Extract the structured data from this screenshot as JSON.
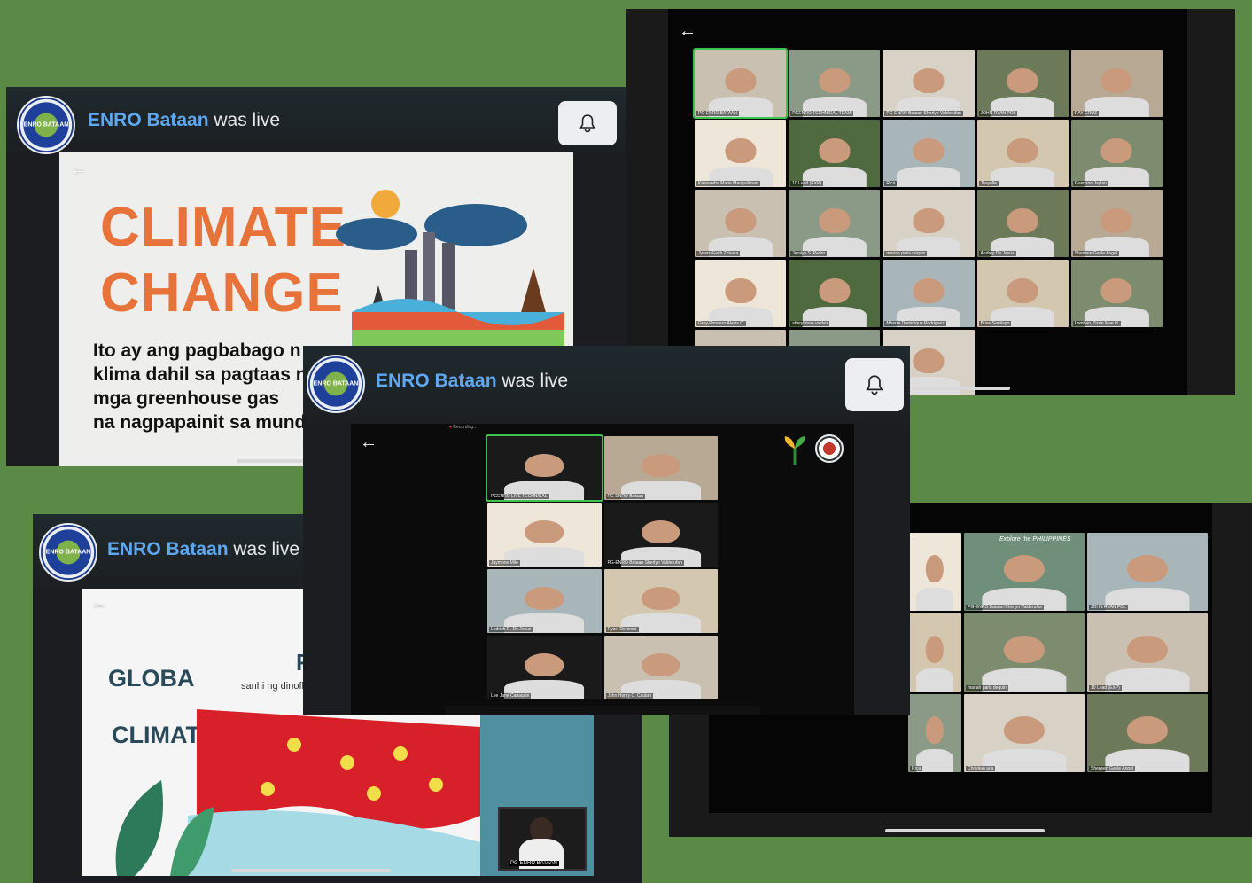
{
  "brand": {
    "name": "ENRO Bataan",
    "suffix": "was live",
    "logo_text": "ENRO BATAAN"
  },
  "colors": {
    "background": "#5b8a47",
    "name_blue": "#5fa7ef",
    "climate_orange": "#e8733a",
    "active_tile_green": "#3cc24e"
  },
  "icons": {
    "bell": "bell-icon",
    "back": "back-arrow-icon"
  },
  "back_glyph": "←",
  "slide1": {
    "title_line1": "CLIMATE",
    "title_line2": "CHANGE",
    "body": [
      "Ito ay ang pagbabago n",
      "klima dahil sa pagtaas n",
      "mga greenhouse gas",
      "na nagpapainit sa mund"
    ]
  },
  "slide2": {
    "word1": "GLOBA",
    "word2": "CLIMAT",
    "subtitle": "sanhi ng dinoflagell",
    "partial_letter": "R",
    "inset_name": "PG-ENRO BATAAN"
  },
  "grid1_names": [
    "PG-ENRO BATAAN",
    "PGENRO TECHNICAL TEAM",
    "PG-ENRO Bataan-Sherlyn Valderufan",
    "JOHN RYAN POL",
    "RAY CRUZ",
    "Kassandra Marie Manguiliman",
    "10 Lead (EXP)",
    "Rica",
    "Jhayelle",
    "Guenzon Jaylan",
    "Jysern Faith Zulueta",
    "Jeralyn S. Pedro",
    "mariah paris dequin",
    "Andrey De Jesus",
    "Sherwen Gayle Angel",
    "Grey Princess Alexis C.",
    "sheryl mae valdez",
    "Mherra Dominique Rodriguez",
    "Brian Santiago",
    "Lombao, Trixie Mae H.",
    "",
    "",
    ""
  ],
  "grid2_names": [
    "PGENRO LIVE TECHNICAL",
    "PG-ENRO Bataan",
    "Jaymone Milo",
    "PG-ENRO Bataan-Sherlyn Valderufan",
    "Ledrich G. De Jesus",
    "Ryzel Dorondo",
    "Lee Jane Cariaquin",
    "John Henry C. Cautan"
  ],
  "grid2_topbar": "Recording...",
  "grid3_names": [
    "",
    "PG-ENRO Bataan-Sherlyn Valderufan",
    "JOHN RYAN POL",
    "",
    "mariah paris dequin",
    "10 Lead (EXP)",
    "Rica",
    "Christian aria",
    "Sherwen Gayle Angel"
  ],
  "grid3_banner": "Explore the PHILIPPINES"
}
